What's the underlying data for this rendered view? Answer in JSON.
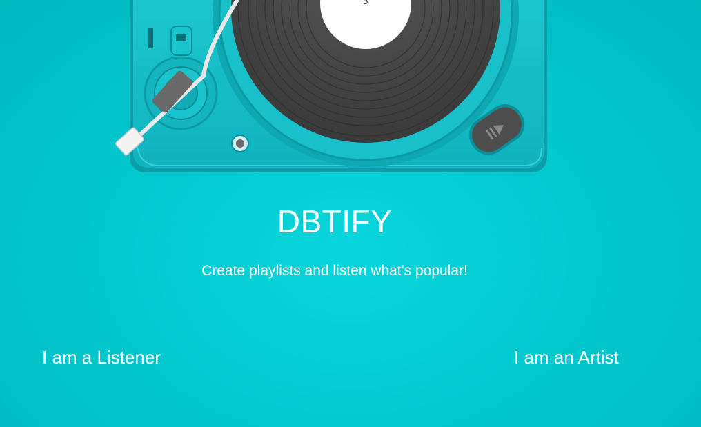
{
  "app": {
    "title": "DBTIFY",
    "tagline": "Create playlists and listen what's popular!"
  },
  "roles": {
    "listener_label": "I am a Listener",
    "artist_label": "I am an Artist"
  },
  "hero": {
    "label_number": "3",
    "icons": [
      "turntable-illustration",
      "vinyl-record-icon",
      "tonearm-icon",
      "play-pause-button-icon"
    ]
  },
  "colors": {
    "background": "#03c9cf",
    "turntable_body": "#16c2cc",
    "record": "#4a4a4a",
    "text": "#ffffff"
  }
}
